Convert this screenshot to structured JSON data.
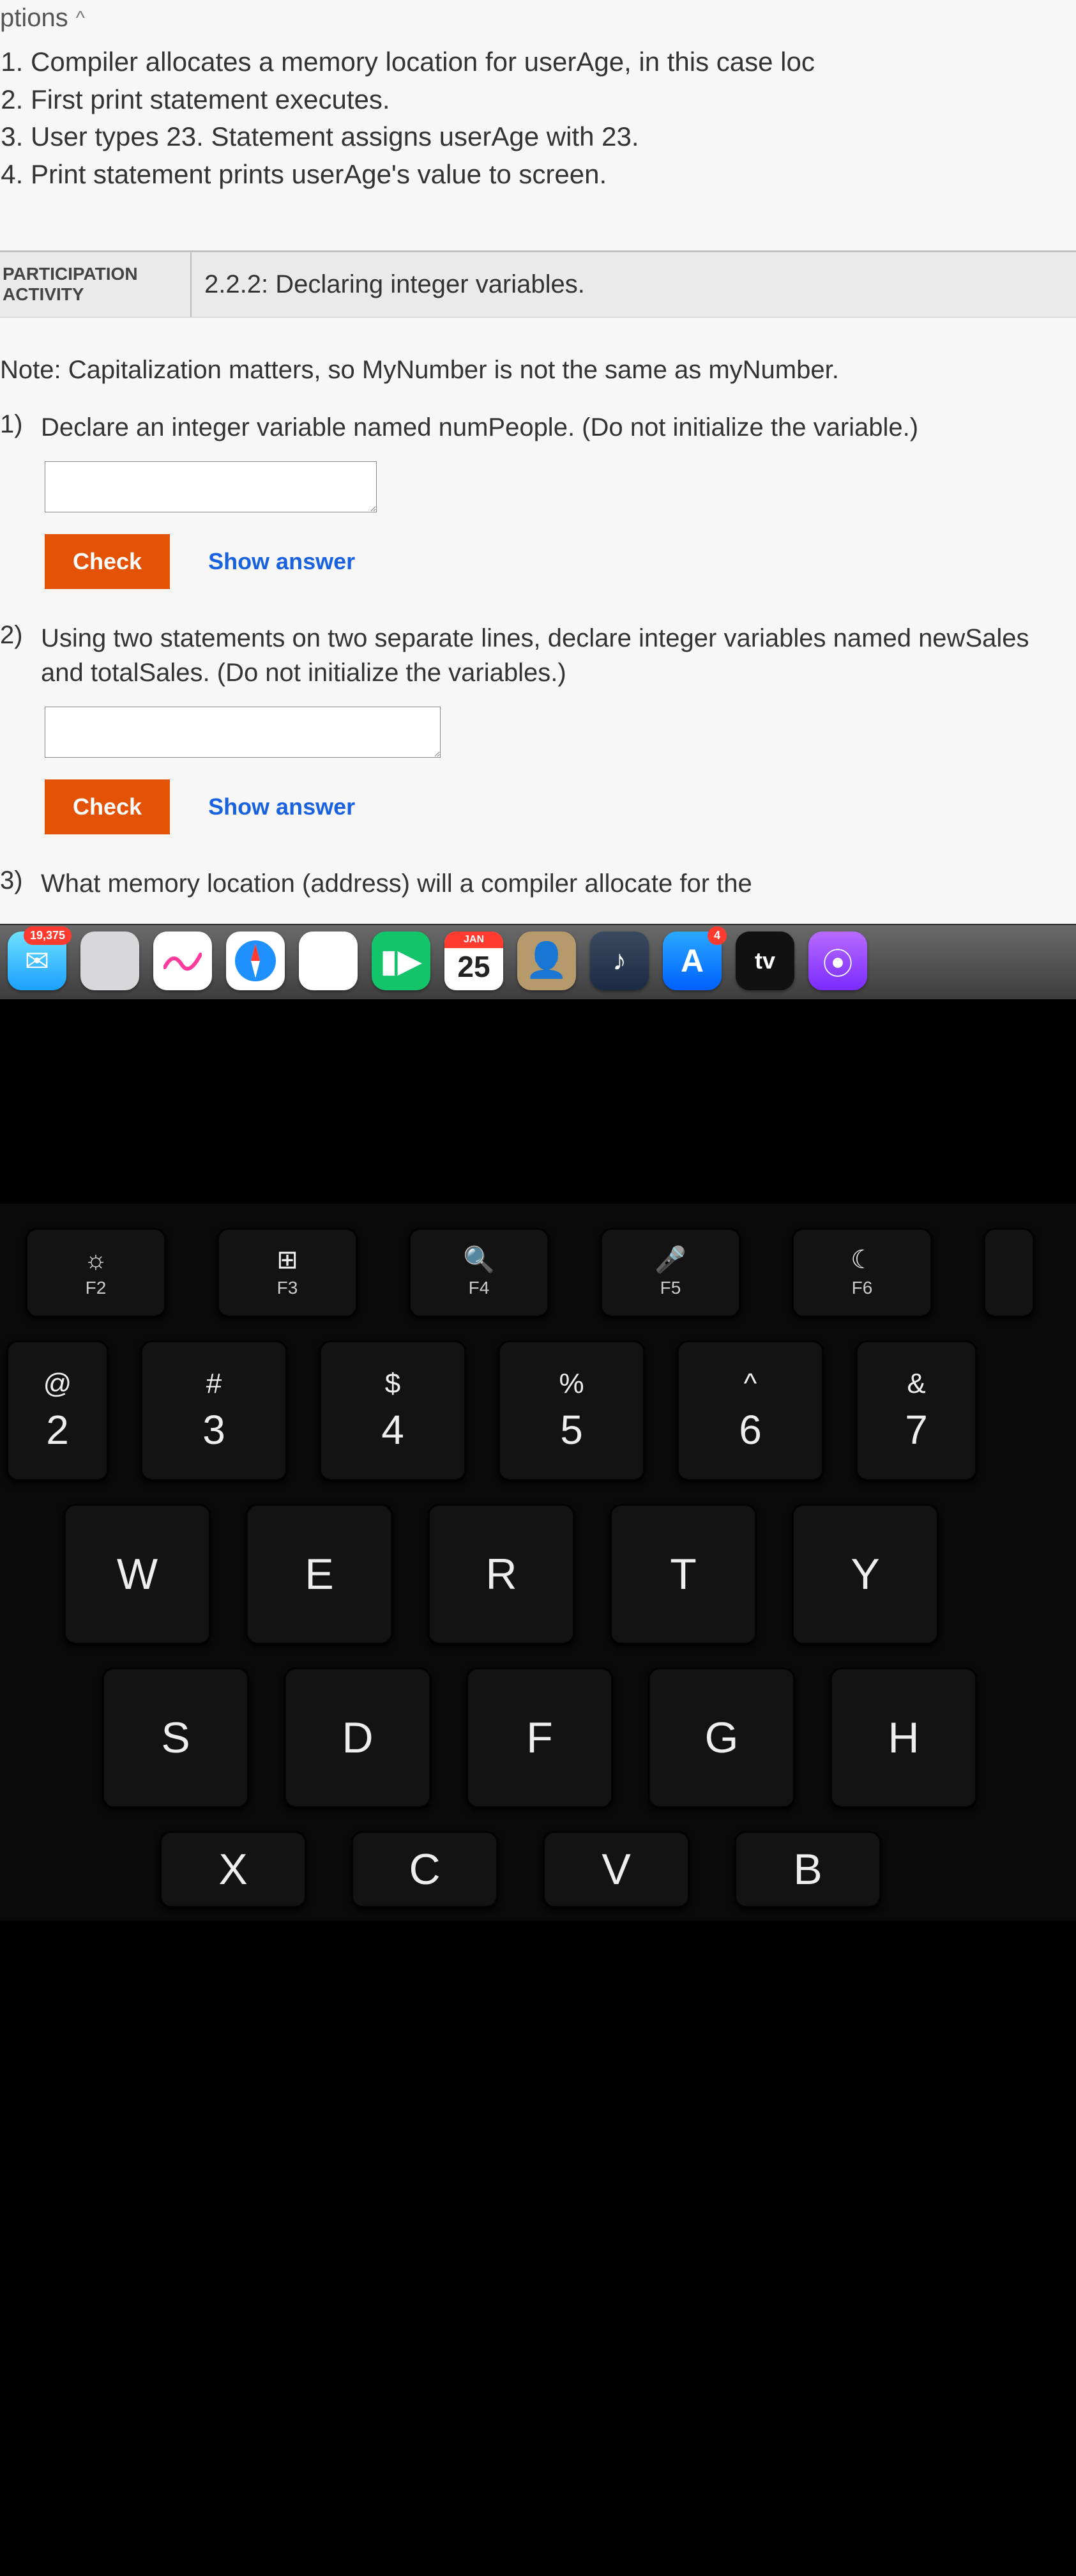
{
  "captions_toggle": {
    "label": "ptions",
    "chevron": "^"
  },
  "captions": [
    "Compiler allocates a memory location for userAge, in this case loc",
    "First print statement executes.",
    "User types 23. Statement assigns userAge with 23.",
    "Print statement prints userAge's value to screen."
  ],
  "activity": {
    "type_line1": "PARTICIPATION",
    "type_line2": "ACTIVITY",
    "title": "2.2.2: Declaring integer variables."
  },
  "note": "Note: Capitalization matters, so MyNumber is not the same as myNumber.",
  "questions": [
    {
      "num": "1)",
      "text": "Declare an integer variable named numPeople. (Do not initialize the variable.)",
      "check": "Check",
      "show": "Show answer"
    },
    {
      "num": "2)",
      "text": "Using two statements on two separate lines, declare integer variables named newSales and totalSales. (Do not initialize the variables.)",
      "check": "Check",
      "show": "Show answer"
    },
    {
      "num": "3)",
      "text": "What memory location (address) will a compiler allocate for the"
    }
  ],
  "dock": {
    "mail_badge": "19,375",
    "calendar_month": "JAN",
    "calendar_day": "25",
    "appstore_badge": "4",
    "tv_label": "tv"
  },
  "keyboard": {
    "fn": [
      {
        "icon": "☼",
        "label": "F2"
      },
      {
        "icon": "⊞",
        "label": "F3"
      },
      {
        "icon": "🔍",
        "label": "F4"
      },
      {
        "icon": "🎤",
        "label": "F5"
      },
      {
        "icon": "☾",
        "label": "F6"
      }
    ],
    "numrow": [
      {
        "sym": "@",
        "dig": "2"
      },
      {
        "sym": "#",
        "dig": "3"
      },
      {
        "sym": "$",
        "dig": "4"
      },
      {
        "sym": "%",
        "dig": "5"
      },
      {
        "sym": "^",
        "dig": "6"
      },
      {
        "sym": "&",
        "dig": "7"
      }
    ],
    "row_qwerty": [
      "W",
      "E",
      "R",
      "T",
      "Y"
    ],
    "row_asdf": [
      "S",
      "D",
      "F",
      "G",
      "H"
    ],
    "row_zxcv": [
      "X",
      "C",
      "V",
      "B"
    ]
  }
}
